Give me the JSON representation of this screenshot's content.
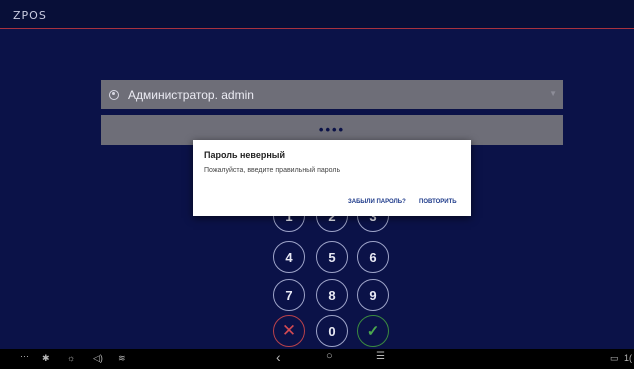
{
  "app": {
    "logo": "ZPOS"
  },
  "login": {
    "user_label": "Администратор. admin",
    "password_mask": "••••"
  },
  "keypad": {
    "keys": [
      "1",
      "2",
      "3",
      "4",
      "5",
      "6",
      "7",
      "8",
      "9",
      "✕",
      "0",
      "✓"
    ]
  },
  "dialog": {
    "title": "Пароль неверный",
    "message": "Пожалуйста, введите правильный пароль",
    "forgot_label": "ЗАБЫЛИ ПАРОЛЬ?",
    "retry_label": "ПОВТОРИТЬ"
  },
  "colors": {
    "background": "#0b1248",
    "accent_line": "#a8323e",
    "cancel": "#d44a52",
    "confirm": "#4ca84f",
    "dialog_button": "#1d3a8a"
  },
  "navbar": {
    "more": "···",
    "back": "‹",
    "home": "○",
    "recents": "☰",
    "clock_partial": "1("
  }
}
